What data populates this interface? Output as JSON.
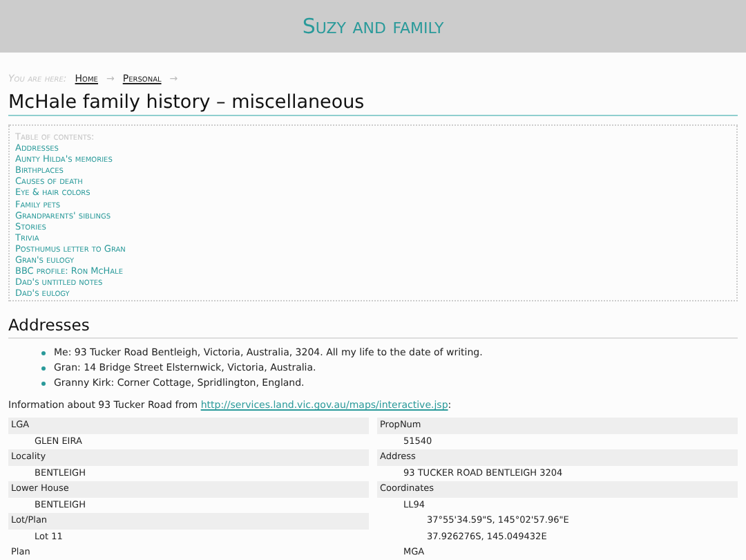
{
  "site_title": "Suzy and family",
  "breadcrumb": {
    "label": "You are here:",
    "links": [
      "Home",
      "Personal"
    ],
    "separator": "→"
  },
  "page_title": "McHale family history – miscellaneous",
  "toc": {
    "label": "Table of contents:",
    "items": [
      "Addresses",
      "Aunty Hilda's memories",
      "Birthplaces",
      "Causes of death",
      "Eye & hair colors",
      "Family pets",
      "Grandparents' siblings",
      "Stories",
      "Trivia",
      "Posthumus letter to Gran",
      "Gran's eulogy",
      "BBC profile: Ron McHale",
      "Dad's untitled notes",
      "Dad's eulogy"
    ]
  },
  "section_heading": "Addresses",
  "addresses": [
    "Me: 93 Tucker Road Bentleigh, Victoria, Australia, 3204. All my life to the date of writing.",
    "Gran: 14 Bridge Street Elsternwick, Victoria, Australia.",
    "Granny Kirk: Corner Cottage, Spridlington, England."
  ],
  "info": {
    "text": "Information about 93 Tucker Road from",
    "link": "http://services.land.vic.gov.au/maps/interactive.jsp",
    "suffix": ":"
  },
  "property_columns": [
    [
      {
        "text": "LGA",
        "children": [
          {
            "text": "GLEN EIRA"
          }
        ]
      },
      {
        "text": "Locality",
        "children": [
          {
            "text": "BENTLEIGH"
          }
        ]
      },
      {
        "text": "Lower House",
        "children": [
          {
            "text": "BENTLEIGH"
          }
        ]
      },
      {
        "text": "Lot/Plan",
        "children": [
          {
            "text": "Lot 11"
          }
        ]
      },
      {
        "text": "Plan"
      }
    ],
    [
      {
        "text": "PropNum",
        "children": [
          {
            "text": "51540"
          }
        ]
      },
      {
        "text": "Address",
        "children": [
          {
            "text": "93 TUCKER ROAD BENTLEIGH 3204"
          }
        ]
      },
      {
        "text": "Coordinates",
        "children": [
          {
            "text": "LL94",
            "children": [
              {
                "text": "37°55'34.59\"S, 145°02'57.96\"E"
              },
              {
                "text": "37.926276S, 145.049432E"
              }
            ]
          },
          {
            "text": "MGA"
          }
        ]
      }
    ]
  ]
}
